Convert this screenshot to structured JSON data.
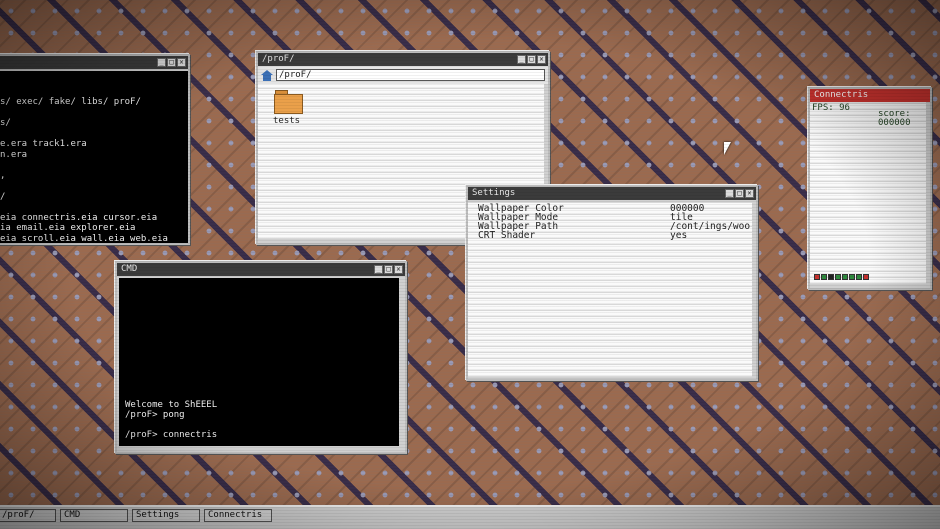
{
  "left_terminal": {
    "lines": [
      "s/ exec/ fake/ libs/ proF/",
      "",
      "s/",
      "",
      "e.era track1.era",
      "n.era",
      "",
      ",",
      "",
      "/",
      "",
      "eia connectris.eia cursor.eia",
      "ia email.eia explorer.eia",
      "eia scroll.eia wall.eia web.eia",
      "eia"
    ]
  },
  "explorer": {
    "title": "/proF/",
    "path": "/proF/",
    "items": [
      {
        "label": "tests",
        "icon": "folder-icon"
      }
    ]
  },
  "settings": {
    "title": "Settings",
    "rows": [
      {
        "key": "Wallpaper Color",
        "value": "000000"
      },
      {
        "key": "Wallpaper Mode",
        "value": "tile"
      },
      {
        "key": "Wallpaper Path",
        "value": "/cont/ings/woo"
      },
      {
        "key": "CRT Shader",
        "value": "yes"
      }
    ]
  },
  "cmd": {
    "title": "CMD",
    "lines": [
      "Welcome to ShEEEL",
      "/proF> pong",
      "",
      "/proF> connectris"
    ]
  },
  "connectris": {
    "title": "Connectris",
    "fps": "FPS: 96",
    "score_label": "score:",
    "score_value": "000000",
    "piece_colors": [
      "#c8322e",
      "#2e8a3e",
      "#222222",
      "#2e8a3e",
      "#2e8a3e",
      "#2e8a3e",
      "#2e8a3e",
      "#c8322e"
    ]
  },
  "taskbar": {
    "items": [
      "/proF/",
      "CMD",
      "Settings",
      "Connectris"
    ]
  },
  "colors": {
    "titlebar": "#3b3b3b",
    "titlebar_active": "#c8322e",
    "terminal_bg": "#000000"
  }
}
